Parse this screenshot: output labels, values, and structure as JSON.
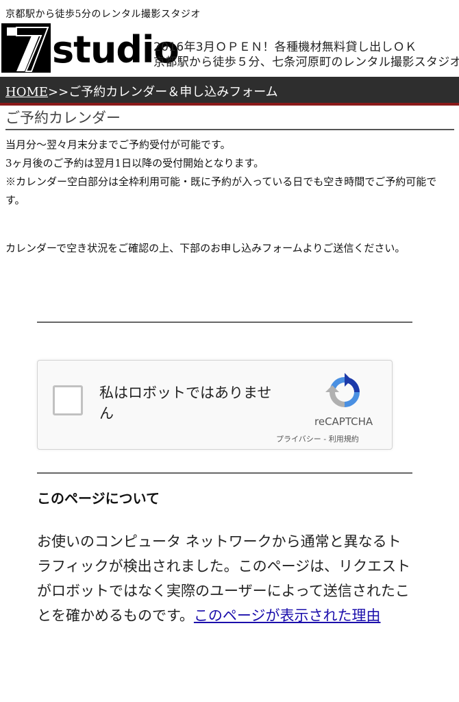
{
  "header": {
    "top_text": "京都駅から徒歩5分のレンタル撮影スタジオ",
    "logo_number": "7",
    "logo_word": "studio",
    "tagline_1": "2016年3月ＯＰＥＮ！各種機材無料貸し出しＯＫ",
    "tagline_2": "京都駅から徒歩５分、七条河原町のレンタル撮影スタジオ"
  },
  "nav": {
    "home_link": "HOME",
    "separator_and_current": ">>ご予約カレンダー＆申し込みフォーム"
  },
  "section": {
    "title": "ご予約カレンダー",
    "line_1": "当月分〜翌々月末分までご予約受付が可能です。",
    "line_2": "3ヶ月後のご予約は翌月1日以降の受付開始となります。",
    "line_3": "※カレンダー空白部分は全枠利用可能・既に予約が入っている日でも空き時間でご予約可能です。",
    "line_4": "カレンダーで空き状況をご確認の上、下部のお申し込みフォームよりご送信ください。"
  },
  "recaptcha": {
    "label": "私はロボットではありません",
    "brand": "reCAPTCHA",
    "privacy": "プライバシー",
    "separator": " - ",
    "terms": "利用規約"
  },
  "about": {
    "title": "このページについて",
    "body": "お使いのコンピュータ ネットワークから通常と異なるトラフィックが検出されました。このページは、リクエストがロボットではなく実際のユーザーによって送信されたことを確かめるものです。",
    "link": "このページが表示された理由"
  },
  "colors": {
    "navbar_bg": "#2e2e2e",
    "navbar_accent": "#8b1a1a",
    "link": "#1a0dab",
    "recaptcha_blue": "#4a90e2",
    "recaptcha_gray": "#b0b0b0"
  }
}
